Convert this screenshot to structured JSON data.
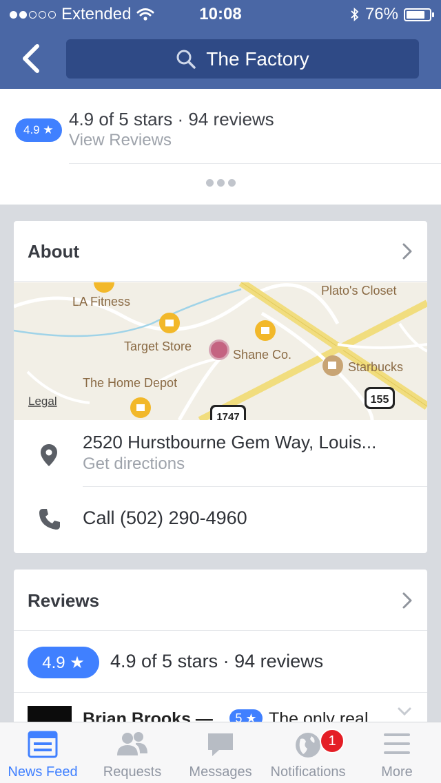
{
  "status_bar": {
    "carrier": "Extended",
    "time": "10:08",
    "battery": "76%",
    "battery_level": 0.76
  },
  "header": {
    "search_text": "The Factory"
  },
  "rating_summary": {
    "badge": "4.9 ★",
    "line": "4.9 of 5 stars · 94 reviews",
    "link": "View Reviews"
  },
  "about": {
    "title": "About",
    "map": {
      "labels": {
        "la_fitness": "LA Fitness",
        "platos_closet": "Plato's Closet",
        "target": "Target Store",
        "shane": "Shane Co.",
        "starbucks": "Starbucks",
        "home_depot": "The Home Depot",
        "legal": "Legal",
        "route_155": "155",
        "route_1747": "1747"
      }
    },
    "address": "2520 Hurstbourne Gem Way, Louis...",
    "directions": "Get directions",
    "call": "Call (502) 290-4960"
  },
  "reviews": {
    "title": "Reviews",
    "badge": "4.9 ★",
    "line": "4.9 of 5 stars · 94 reviews",
    "peek": {
      "name": "Brian Brooks —",
      "badge": "5 ★",
      "text": "The only real"
    }
  },
  "tabbar": {
    "items": [
      {
        "label": "News Feed",
        "icon": "news-feed-icon",
        "active": true
      },
      {
        "label": "Requests",
        "icon": "friend-requests-icon"
      },
      {
        "label": "Messages",
        "icon": "messages-icon"
      },
      {
        "label": "Notifications",
        "icon": "globe-icon",
        "count": "1"
      },
      {
        "label": "More",
        "icon": "hamburger-icon"
      }
    ]
  },
  "colors": {
    "header_blue": "#4a67a5",
    "search_blue": "#2f4a86",
    "accent_blue": "#4080ff",
    "notification_red": "#e41e26"
  }
}
